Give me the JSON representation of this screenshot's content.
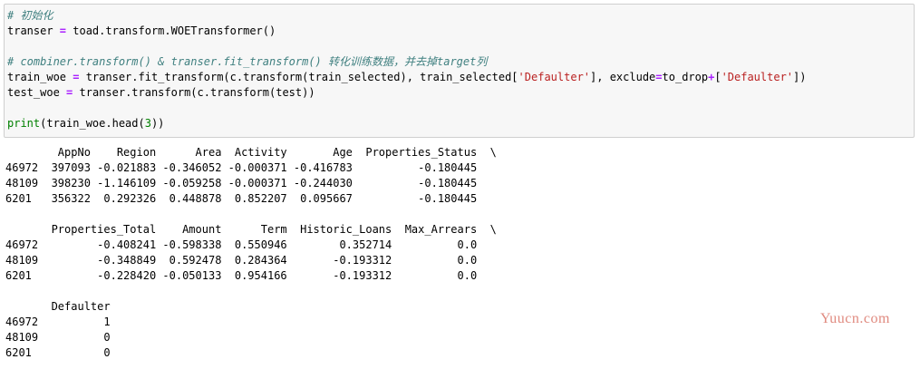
{
  "input_cell": {
    "lines": [
      {
        "parts": [
          {
            "t": "# 初始化",
            "c": "cmt"
          }
        ]
      },
      {
        "parts": [
          {
            "t": "transer ",
            "c": ""
          },
          {
            "t": "=",
            "c": "op"
          },
          {
            "t": " toad.transform.WOETransformer()",
            "c": ""
          }
        ]
      },
      {
        "parts": []
      },
      {
        "parts": [
          {
            "t": "# combiner.transform() & transer.fit_transform() 转化训练数据，并去掉target列",
            "c": "cmt"
          }
        ]
      },
      {
        "parts": [
          {
            "t": "train_woe ",
            "c": ""
          },
          {
            "t": "=",
            "c": "op"
          },
          {
            "t": " transer.fit_transform(c.transform(train_selected), train_selected[",
            "c": ""
          },
          {
            "t": "'Defaulter'",
            "c": "str"
          },
          {
            "t": "], exclude",
            "c": ""
          },
          {
            "t": "=",
            "c": "op"
          },
          {
            "t": "to_drop",
            "c": ""
          },
          {
            "t": "+",
            "c": "op"
          },
          {
            "t": "[",
            "c": ""
          },
          {
            "t": "'Defaulter'",
            "c": "str"
          },
          {
            "t": "])",
            "c": ""
          }
        ]
      },
      {
        "parts": [
          {
            "t": "test_woe ",
            "c": ""
          },
          {
            "t": "=",
            "c": "op"
          },
          {
            "t": " transer.transform(c.transform(test))",
            "c": ""
          }
        ]
      },
      {
        "parts": []
      },
      {
        "parts": [
          {
            "t": "print",
            "c": "kw"
          },
          {
            "t": "(train_woe.head(",
            "c": ""
          },
          {
            "t": "3",
            "c": "num"
          },
          {
            "t": "))",
            "c": ""
          }
        ]
      }
    ]
  },
  "output_cell": {
    "lines": [
      "        AppNo    Region      Area  Activity       Age  Properties_Status  \\",
      "46972  397093 -0.021883 -0.346052 -0.000371 -0.416783          -0.180445   ",
      "48109  398230 -1.146109 -0.059258 -0.000371 -0.244030          -0.180445   ",
      "6201   356322  0.292326  0.448878  0.852207  0.095667          -0.180445   ",
      "",
      "       Properties_Total    Amount      Term  Historic_Loans  Max_Arrears  \\",
      "46972         -0.408241 -0.598338  0.550946        0.352714          0.0   ",
      "48109         -0.348849  0.592478  0.284364       -0.193312          0.0   ",
      "6201          -0.228420 -0.050133  0.954166       -0.193312          0.0   ",
      "",
      "       Defaulter  ",
      "46972          1  ",
      "48109          0  ",
      "6201           0  "
    ]
  },
  "watermark": "Yuucn.com"
}
